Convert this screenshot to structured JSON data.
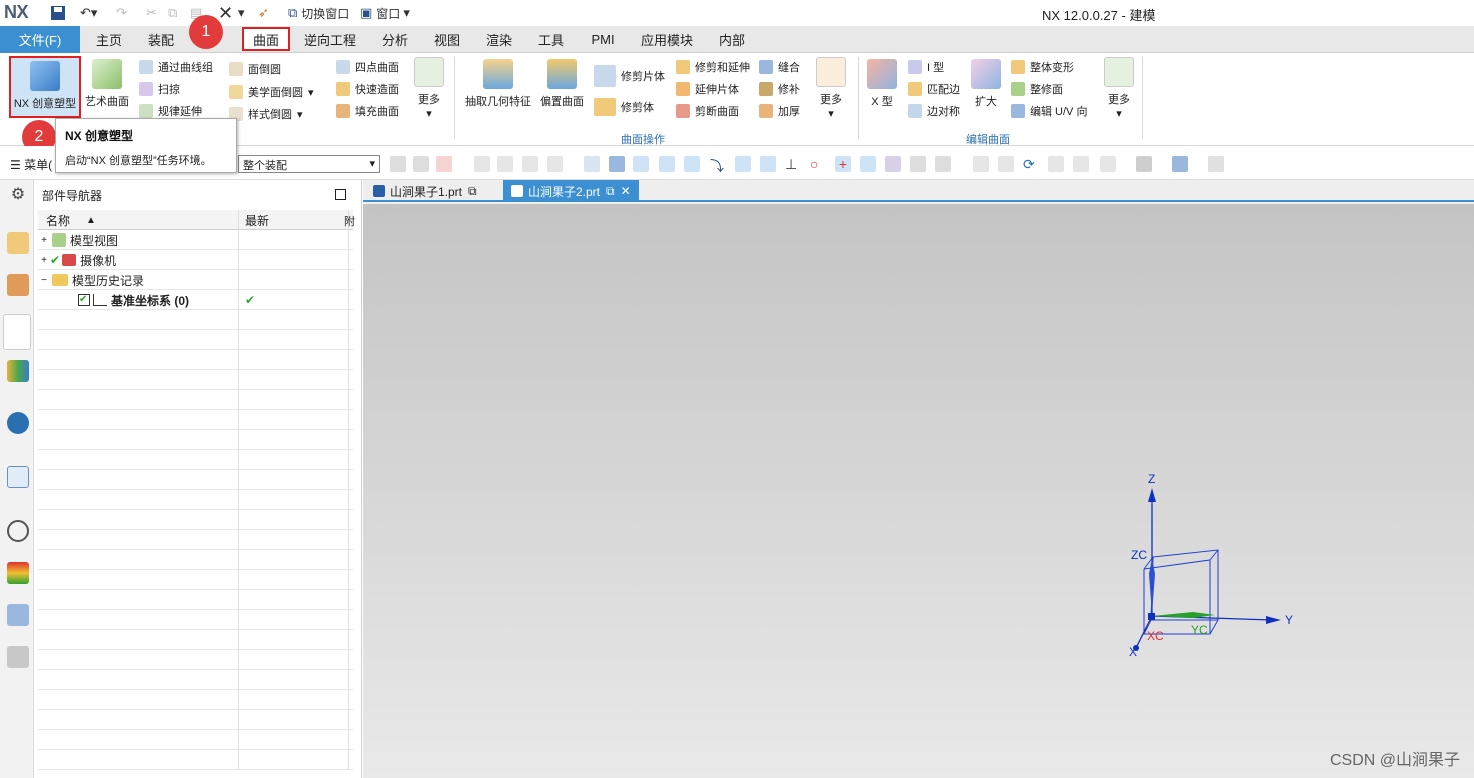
{
  "app": {
    "logo": "NX",
    "window_title": "NX 12.0.0.27 - 建模",
    "switch_window": "切换窗口",
    "window_menu": "窗口"
  },
  "menu": {
    "file": "文件(F)",
    "tabs": [
      "主页",
      "装配",
      "曲面",
      "逆向工程",
      "分析",
      "视图",
      "渲染",
      "工具",
      "PMI",
      "应用模块",
      "内部"
    ],
    "active_tab": "曲面"
  },
  "ribbon": {
    "nx_realize_shape": "NX 创意塑型",
    "art_surface": "艺术曲面",
    "through_curve_mesh": "通过曲线组",
    "sweep": "扫掠",
    "law_extension": "规律延伸",
    "face_blend": "面倒圆",
    "aesthetic_face_blend": "美学面倒圆",
    "styled_blend": "样式倒圆",
    "four_point_surface": "四点曲面",
    "rapid_surfacing": "快速造面",
    "fill_surface": "填充曲面",
    "more_1": "更多",
    "extract_geometry": "抽取几何特征",
    "offset_surface": "偏置曲面",
    "trimmed_sheet": "修剪片体",
    "trim_body": "修剪体",
    "trim_extend": "修剪和延伸",
    "extend_sheet": "延伸片体",
    "divide_face": "剪断曲面",
    "sew": "缝合",
    "patch": "修补",
    "thicken": "加厚",
    "more_2": "更多",
    "group_surface_ops": "曲面操作",
    "x_form": "X 型",
    "i_form": "I 型",
    "match_edge": "匹配边",
    "edge_symmetry": "边对称",
    "enlarge": "扩大",
    "global_shaping": "整体变形",
    "refit_face": "整修面",
    "edit_uv": "编辑 U/V 向",
    "more_3": "更多",
    "group_edit_surface": "编辑曲面"
  },
  "tooltip": {
    "title": "NX 创意塑型",
    "desc": "启动“NX 创意塑型”任务环境。"
  },
  "badges": {
    "step1": "1",
    "step2": "2"
  },
  "toolbar": {
    "menu_label": "菜单(",
    "assembly_scope": "整个装配"
  },
  "navigator": {
    "title": "部件导航器",
    "col_name": "名称",
    "col_latest": "最新",
    "col_extra": "附",
    "rows": [
      {
        "label": "模型视图",
        "latest": ""
      },
      {
        "label": "摄像机",
        "latest": ""
      },
      {
        "label": "模型历史记录",
        "latest": ""
      },
      {
        "label": "基准坐标系 (0)",
        "latest": "✔"
      }
    ]
  },
  "doc_tabs": [
    {
      "label": "山涧果子1.prt"
    },
    {
      "label": "山涧果子2.prt"
    }
  ],
  "triad": {
    "z": "Z",
    "zc": "ZC",
    "y": "Y",
    "yc": "YC",
    "x": "X",
    "xc": "XC"
  },
  "watermark": "CSDN @山涧果子"
}
